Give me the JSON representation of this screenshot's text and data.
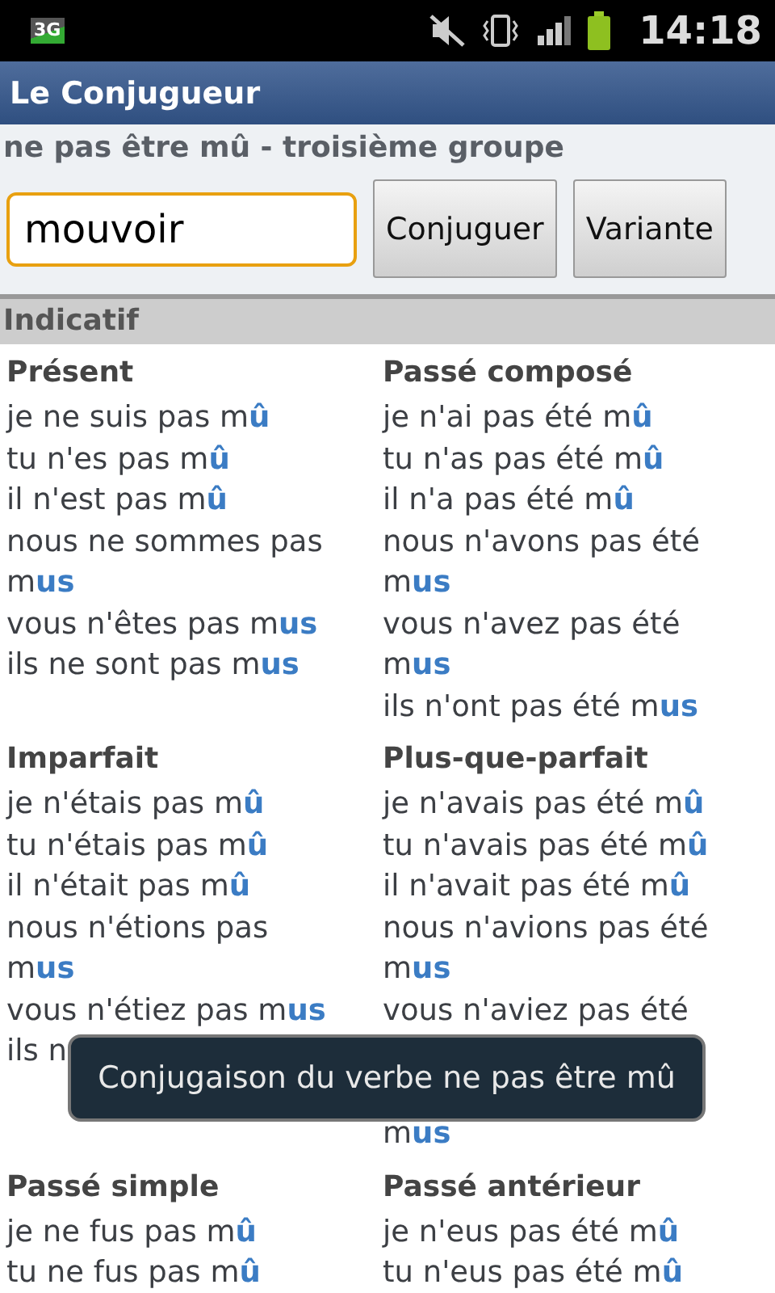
{
  "status_bar": {
    "network": "3G",
    "time": "14:18"
  },
  "app_bar": {
    "title": "Le Conjugueur"
  },
  "subtitle": "ne pas être mû - troisième groupe",
  "search": {
    "value": "mouvoir",
    "focused": true
  },
  "buttons": [
    "Conjuguer",
    "Variante"
  ],
  "mood": "Indicatif",
  "tenses": [
    {
      "name": "Présent",
      "forms": [
        {
          "text": "je ne suis pas m**û**"
        },
        {
          "text": "tu n'es pas m**û**"
        },
        {
          "text": "il n'est pas m**û**"
        },
        {
          "text": "nous ne sommes pas m**us**"
        },
        {
          "text": "vous n'êtes pas m**us**"
        },
        {
          "text": "ils ne sont pas m**us**"
        }
      ]
    },
    {
      "name": "Passé composé",
      "forms": [
        {
          "text": "je n'ai pas été m**û**"
        },
        {
          "text": "tu n'as pas été m**û**"
        },
        {
          "text": "il n'a pas été m**û**"
        },
        {
          "text": "nous n'avons pas été m**us**"
        },
        {
          "text": "vous n'avez pas été m**us**"
        },
        {
          "text": "ils n'ont pas été m**us**"
        }
      ]
    },
    {
      "name": "Imparfait",
      "forms": [
        {
          "text": "je n'étais pas m**û**"
        },
        {
          "text": "tu n'étais pas m**û**"
        },
        {
          "text": "il n'était pas m**û**"
        },
        {
          "text": "nous n'étions pas m**us**"
        },
        {
          "text": "vous n'étiez pas m**us**"
        },
        {
          "text": "ils n"
        }
      ]
    },
    {
      "name": "Plus-que-parfait",
      "forms": [
        {
          "text": "je n'avais pas été m**û**"
        },
        {
          "text": "tu n'avais pas été m**û**"
        },
        {
          "text": "il n'avait pas été m**û**"
        },
        {
          "text": "nous n'avions pas été m**us**"
        },
        {
          "text": "vous n'aviez pas été"
        }
      ],
      "forms_below_toast": [
        {
          "text": "m**us**"
        }
      ]
    },
    {
      "name": "Passé simple",
      "forms": [
        {
          "text": "je ne fus pas m**û**"
        },
        {
          "text": "tu ne fus pas m**û**"
        }
      ]
    },
    {
      "name": "Passé antérieur",
      "forms": [
        {
          "text": "je n'eus pas été m**û**"
        },
        {
          "text": "tu n'eus pas été m**û**"
        }
      ]
    }
  ],
  "toast": "Conjugaison du verbe ne pas être mû"
}
